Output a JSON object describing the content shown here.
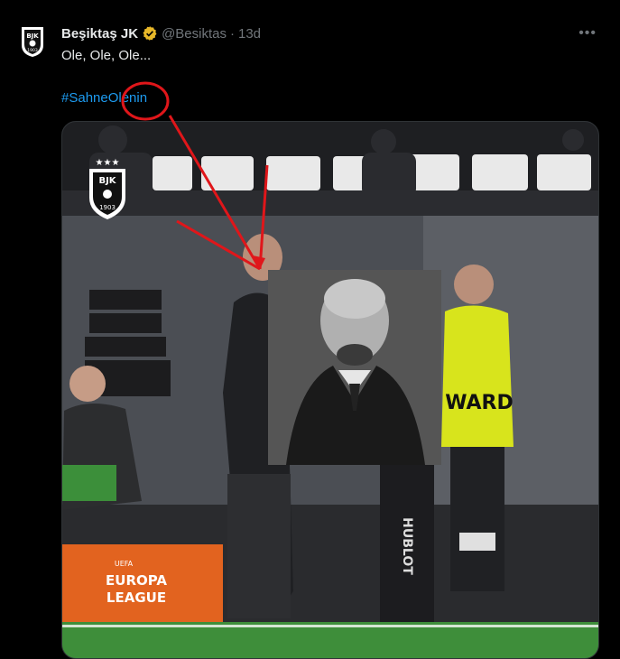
{
  "post": {
    "author_name": "Beşiktaş JK",
    "author_handle": "@Besiktas",
    "separator": "·",
    "time": "13d",
    "more_label": "•••",
    "text": "Ole, Ole, Ole...",
    "hashtag": "#SahneOlenin",
    "verified_color": "#e8b829"
  },
  "media": {
    "logo_text": "BJK",
    "logo_year": "1903",
    "vest_text": "WARD",
    "league_text_1": "EUROPA",
    "league_text_2": "LEAGUE",
    "league_uefa": "UEFA",
    "sponsor_text": "HUBLOT"
  },
  "annotation": {
    "color": "#e0161a"
  }
}
